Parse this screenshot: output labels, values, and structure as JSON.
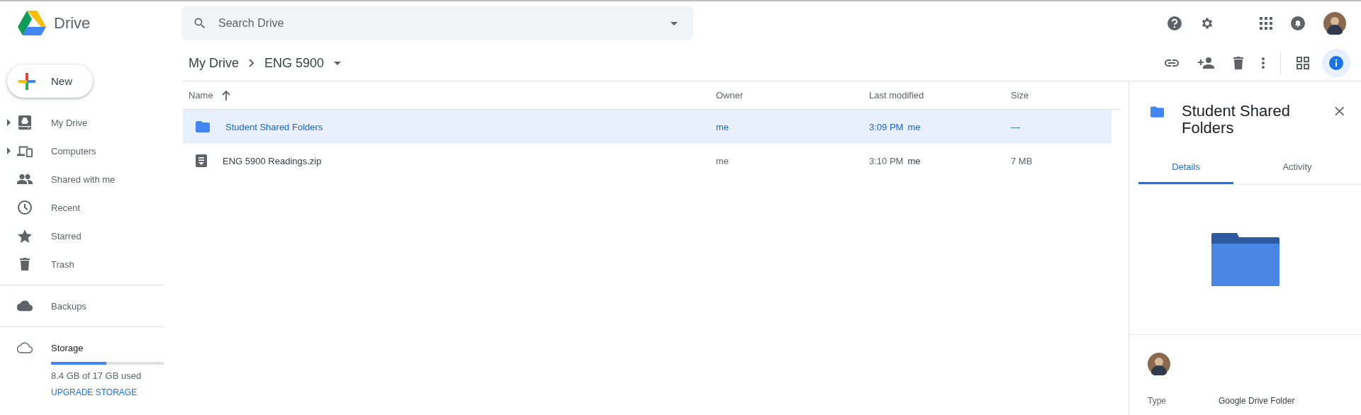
{
  "header": {
    "logo_text": "Drive",
    "search": {
      "placeholder": "Search Drive"
    }
  },
  "sidebar": {
    "new_button": "New",
    "items": [
      {
        "label": "My Drive",
        "expandable": true
      },
      {
        "label": "Computers",
        "expandable": true
      },
      {
        "label": "Shared with me",
        "expandable": false
      },
      {
        "label": "Recent",
        "expandable": false
      },
      {
        "label": "Starred",
        "expandable": false
      },
      {
        "label": "Trash",
        "expandable": false
      }
    ],
    "backups": {
      "label": "Backups"
    },
    "storage": {
      "label": "Storage",
      "level": 0.49,
      "usage": "8.4 GB of 17 GB used",
      "upgrade": "UPGRADE STORAGE"
    }
  },
  "breadcrumb": [
    "My Drive",
    "ENG 5900"
  ],
  "table": {
    "columns": [
      "Name",
      "Owner",
      "Last modified",
      "Size"
    ],
    "rows": [
      {
        "kind": "folder",
        "name": "Student Shared Folders",
        "owner": "me",
        "modified_time": "3:09 PM",
        "modified_by": "me",
        "size": "—",
        "selected": true
      },
      {
        "kind": "file",
        "name": "ENG 5900 Readings.zip",
        "owner": "me",
        "modified_time": "3:10 PM",
        "modified_by": "me",
        "size": "7 MB",
        "selected": false
      }
    ]
  },
  "details_panel": {
    "title": "Student Shared Folders",
    "tabs": [
      {
        "label": "Details",
        "selected": true
      },
      {
        "label": "Activity",
        "selected": false
      }
    ],
    "properties": [
      {
        "label": "Type",
        "value": "Google Drive Folder"
      }
    ]
  }
}
